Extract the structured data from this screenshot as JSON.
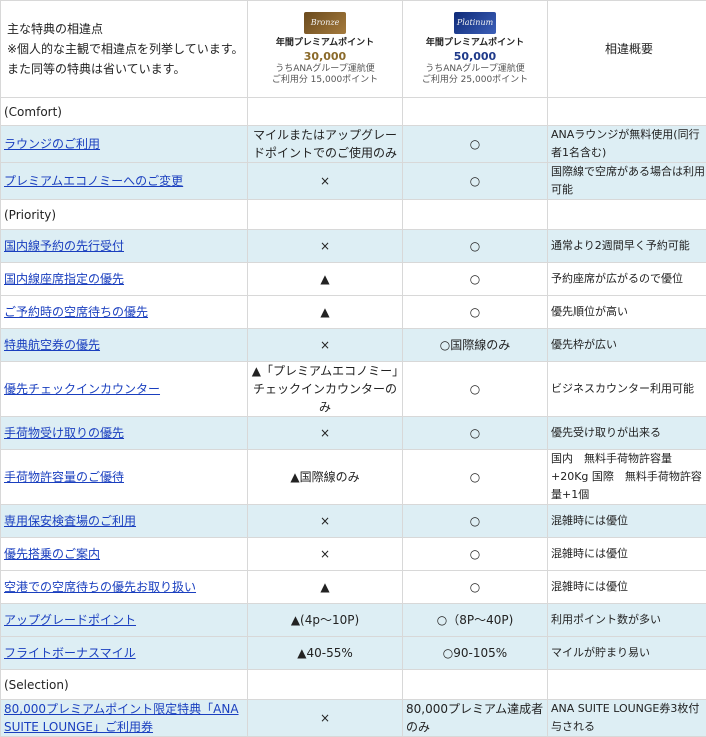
{
  "header": {
    "line1": "主な特典の相違点",
    "line2": "※個人的な主観で相違点を列挙しています。",
    "line3": "また同等の特典は省いています。",
    "bronze": {
      "card_text": "Bronze",
      "label": "年間プレミアムポイント",
      "points": "30,000",
      "sub1": "うちANAグループ運航便",
      "sub2": "ご利用分 15,000ポイント"
    },
    "platinum": {
      "card_text": "Platinum",
      "label": "年間プレミアムポイント",
      "points": "50,000",
      "sub1": "うちANAグループ運航便",
      "sub2": "ご利用分 25,000ポイント"
    },
    "diff_title": "相違概要"
  },
  "sections": {
    "comfort": "(Comfort)",
    "priority": "(Priority)",
    "selection": "(Selection)"
  },
  "rows": [
    {
      "name": "ラウンジのご利用",
      "bronze": "マイルまたはアップグレードポイントでのご使用のみ",
      "platinum": "○",
      "diff": "ANAラウンジが無料使用(同行者1名含む)"
    },
    {
      "name": "プレミアムエコノミーへのご変更",
      "bronze": "×",
      "platinum": "○",
      "diff": "国際線で空席がある場合は利用可能"
    },
    {
      "name": "国内線予約の先行受付",
      "bronze": "×",
      "platinum": "○",
      "diff": "通常より2週間早く予約可能"
    },
    {
      "name": "国内線座席指定の優先",
      "bronze": "▲",
      "platinum": "○",
      "diff": "予約座席が広がるので優位"
    },
    {
      "name": "ご予約時の空席待ちの優先",
      "bronze": "▲",
      "platinum": "○",
      "diff": "優先順位が高い"
    },
    {
      "name": "特典航空券の優先",
      "bronze": "×",
      "platinum": "○国際線のみ",
      "diff": "優先枠が広い"
    },
    {
      "name": "優先チェックインカウンター",
      "bronze": "▲「プレミアムエコノミー」チェックインカウンターのみ",
      "platinum": "○",
      "diff": "ビジネスカウンター利用可能"
    },
    {
      "name": "手荷物受け取りの優先",
      "bronze": "×",
      "platinum": "○",
      "diff": "優先受け取りが出来る"
    },
    {
      "name": "手荷物許容量のご優待",
      "bronze": "▲国際線のみ",
      "platinum": "○",
      "diff": "国内　無料手荷物許容量+20Kg 国際　無料手荷物許容量+1個"
    },
    {
      "name": "専用保安検査場のご利用",
      "bronze": "×",
      "platinum": "○",
      "diff": "混雑時には優位"
    },
    {
      "name": "優先搭乗のご案内",
      "bronze": "×",
      "platinum": "○",
      "diff": "混雑時には優位"
    },
    {
      "name": "空港での空席待ちの優先お取り扱い",
      "bronze": "▲",
      "platinum": "○",
      "diff": "混雑時には優位"
    },
    {
      "name": "アップグレードポイント",
      "bronze": "▲(4p～10P)",
      "platinum": "○（8P～40P)",
      "diff": "利用ポイント数が多い"
    },
    {
      "name": "フライトボーナスマイル",
      "bronze": "▲40-55%",
      "platinum": "○90-105%",
      "diff": "マイルが貯まり易い"
    },
    {
      "name": "80,000プレミアムポイント限定特典「ANA SUITE LOUNGE」ご利用券",
      "bronze": "×",
      "platinum": "80,000プレミアム達成者のみ",
      "diff": "ANA SUITE LOUNGE券3枚付与される"
    }
  ]
}
